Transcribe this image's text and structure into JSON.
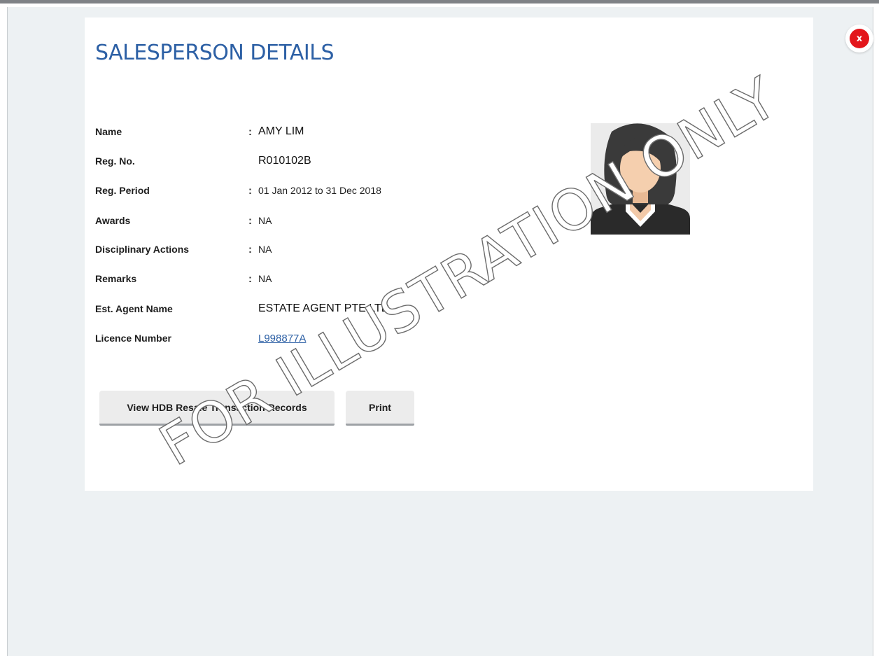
{
  "close_button": {
    "label": "x",
    "color": "#e3161b"
  },
  "panel": {
    "title": "SALESPERSON DETAILS",
    "title_color": "#2d60a5",
    "photo_icon": "female-avatar-icon"
  },
  "details": {
    "name": {
      "label": "Name",
      "colon": ":",
      "value": "AMY LIM"
    },
    "reg_no": {
      "label": "Reg. No.",
      "colon": "",
      "value": "R010102B"
    },
    "reg_period": {
      "label": "Reg. Period",
      "colon": ":",
      "value": "01 Jan 2012 to 31 Dec 2018"
    },
    "awards": {
      "label": "Awards",
      "colon": ":",
      "value": "NA"
    },
    "disciplinary_actions": {
      "label": "Disciplinary Actions",
      "colon": ":",
      "value": "NA"
    },
    "remarks": {
      "label": "Remarks",
      "colon": ":",
      "value": "NA"
    },
    "est_agent_name": {
      "label": "Est. Agent Name",
      "colon": "",
      "value": "ESTATE AGENT PTE LTD"
    },
    "licence_number": {
      "label": "Licence Number",
      "colon": "",
      "value": "L998877A"
    }
  },
  "buttons": {
    "view_records": "View HDB Resale Transaction Records",
    "print": "Print"
  },
  "watermark": "FOR ILLUSTRATION ONLY"
}
